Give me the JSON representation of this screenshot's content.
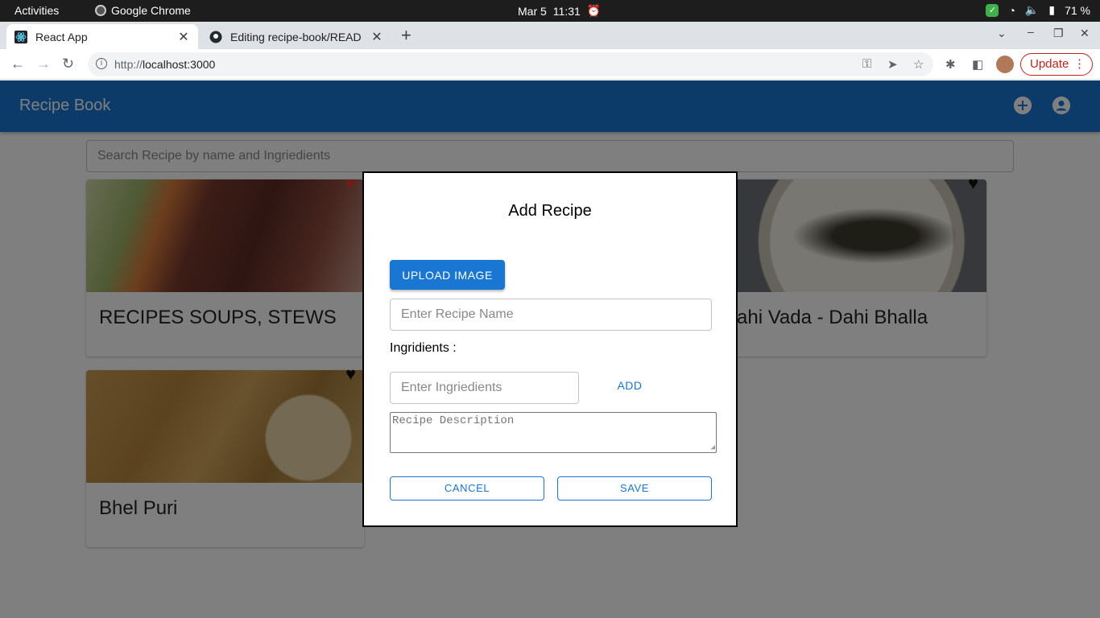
{
  "system_bar": {
    "activities": "Activities",
    "app_name": "Google Chrome",
    "date": "Mar 5",
    "time": "11:31",
    "battery": "71 %"
  },
  "browser": {
    "tabs": [
      {
        "title": "React App",
        "active": true
      },
      {
        "title": "Editing recipe-book/READ",
        "active": false
      }
    ],
    "url_prefix": "http://",
    "url_host": "localhost:3000",
    "update_label": "Update"
  },
  "app": {
    "brand": "Recipe Book",
    "search_placeholder": "Search Recipe by name and Ingriedients",
    "cards": [
      {
        "title": "RECIPES SOUPS, STEWS",
        "favorite": true
      },
      {
        "title": "ahi Vada - Dahi Bhalla",
        "favorite": false
      },
      {
        "title": "Bhel Puri",
        "favorite": false
      }
    ]
  },
  "modal": {
    "title": "Add Recipe",
    "upload_label": "UPLOAD IMAGE",
    "name_placeholder": "Enter Recipe Name",
    "ingredients_label": "Ingridients :",
    "ingredient_placeholder": "Enter Ingriedients",
    "add_label": "ADD",
    "description_placeholder": "Recipe Description",
    "cancel_label": "CANCEL",
    "save_label": "SAVE"
  },
  "colors": {
    "primary": "#1976d2",
    "favorite_active": "#e53935",
    "favorite_inactive": "#111111"
  }
}
